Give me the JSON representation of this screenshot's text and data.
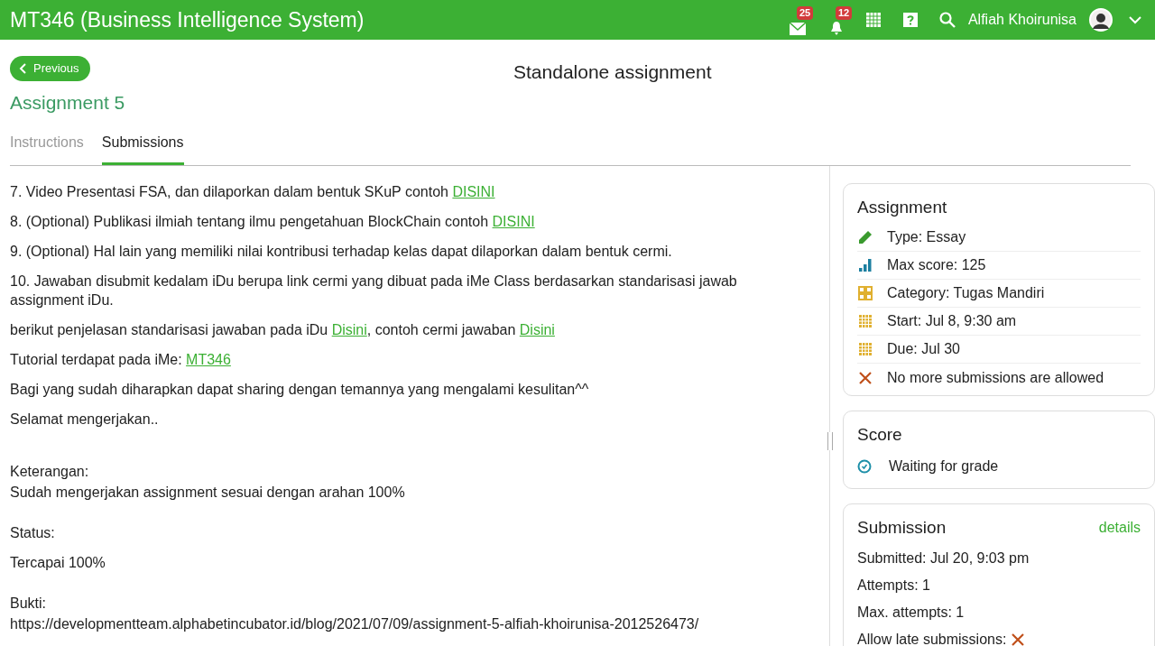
{
  "header": {
    "title": "MT346 (Business Intelligence System)",
    "mail_count": "25",
    "notification_count": "12",
    "user_name": "Alfiah Khoirunisa"
  },
  "page": {
    "back_button": "Previous",
    "title": "Standalone assignment",
    "assignment_title": "Assignment 5"
  },
  "tabs": [
    {
      "label": "Instructions",
      "selected": false
    },
    {
      "label": "Submissions",
      "selected": true
    }
  ],
  "content": [
    {
      "parts": [
        {
          "text": "7. Video Presentasi FSA, dan dilaporkan dalam bentuk SKuP contoh "
        },
        {
          "text": "DISINI",
          "link": true
        }
      ]
    },
    {
      "parts": [
        {
          "text": "8. (Optional) Publikasi ilmiah tentang ilmu pengetahuan BlockChain contoh "
        },
        {
          "text": "DISINI",
          "link": true
        }
      ]
    },
    {
      "parts": [
        {
          "text": "9. (Optional) Hal lain yang memiliki nilai kontribusi terhadap kelas dapat dilaporkan dalam bentuk cermi."
        }
      ]
    },
    {
      "parts": [
        {
          "text": "10. Jawaban disubmit kedalam iDu berupa link cermi yang dibuat pada iMe Class berdasarkan standarisasi jawab assignment iDu."
        }
      ]
    },
    {
      "parts": [
        {
          "text": "berikut penjelasan standarisasi jawaban pada iDu "
        },
        {
          "text": "Disini",
          "link": true
        },
        {
          "text": ", contoh cermi jawaban "
        },
        {
          "text": "Disini",
          "link": true
        }
      ]
    },
    {
      "parts": [
        {
          "text": "Tutorial terdapat pada iMe: "
        },
        {
          "text": "MT346",
          "link": true
        }
      ]
    },
    {
      "parts": [
        {
          "text": "Bagi yang sudah diharapkan dapat sharing dengan temannya yang mengalami kesulitan^^"
        }
      ]
    },
    {
      "parts": [
        {
          "text": "Selamat mengerjakan.."
        }
      ]
    }
  ],
  "submission_text": [
    {
      "label": "Keterangan:",
      "value": "Sudah mengerjakan assignment sesuai dengan arahan 100%"
    },
    {
      "label": "Status:",
      "value": "Tercapai 100%"
    },
    {
      "label": "Bukti:",
      "value": "https://developmentteam.alphabetincubator.id/blog/2021/07/09/assignment-5-alfiah-khoirunisa-2012526473/"
    }
  ],
  "assignment_card": {
    "title": "Assignment",
    "items": [
      {
        "kind": "type",
        "text": "Type: Essay"
      },
      {
        "kind": "score",
        "text": "Max score: 125"
      },
      {
        "kind": "category",
        "text": "Category: Tugas Mandiri"
      },
      {
        "kind": "date",
        "text": "Start: Jul 8, 9:30 am"
      },
      {
        "kind": "date",
        "text": "Due: Jul 30"
      },
      {
        "kind": "closed",
        "text": "No more submissions are allowed"
      }
    ]
  },
  "score_card": {
    "title": "Score",
    "status": "Waiting for grade"
  },
  "submission_card": {
    "title": "Submission",
    "details_link": "details",
    "lines": [
      "Submitted: Jul 20, 9:03 pm",
      "Attempts: 1",
      "Max. attempts: 1"
    ],
    "late_label": "Allow late submissions:",
    "late_allowed": false
  }
}
